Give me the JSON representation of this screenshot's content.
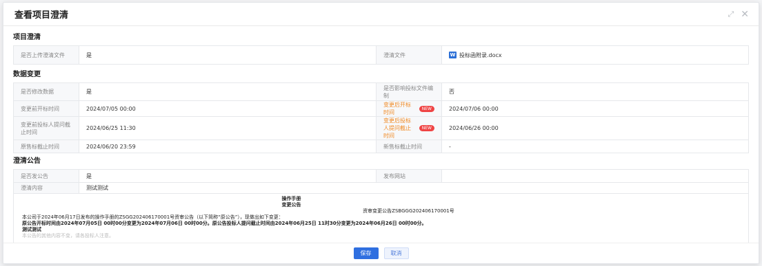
{
  "dialog": {
    "title": "查看项目澄清",
    "icons": [
      "expand-icon",
      "close-icon"
    ],
    "expand_glyph": "⤢",
    "close_glyph": "✕"
  },
  "clarification": {
    "section_title": "项目澄清",
    "upload_label": "是否上传澄清文件",
    "upload_value": "是",
    "file_label": "澄清文件",
    "file_name": "投标函附录.docx",
    "file_icon": "word-doc-icon"
  },
  "data_change": {
    "section_title": "数据变更",
    "modify_label": "是否修改数据",
    "modify_value": "是",
    "affect_label": "是否影响投标文件编制",
    "affect_value": "否",
    "before_open_label": "变更前开标时间",
    "before_open_value": "2024/07/05 00:00",
    "after_open_label": "变更后开标时间",
    "after_open_value": "2024/07/06 00:00",
    "before_question_label": "变更前投标人提问截止时间",
    "before_question_value": "2024/06/25 11:30",
    "after_question_label": "变更后投标人提问截止时间",
    "after_question_value": "2024/06/26 00:00",
    "orig_sale_label": "原售标截止时间",
    "orig_sale_value": "2024/06/20 23:59",
    "new_sale_label": "新售标截止时间",
    "new_sale_value": "-",
    "new_badge": "NEW"
  },
  "notice": {
    "section_title": "澄清公告",
    "publish_label": "是否发公告",
    "publish_value": "是",
    "site_label": "发布网站",
    "site_value": "",
    "content_label": "澄清内容",
    "content_value": "测试测试",
    "line1": "操作手册",
    "line2": "变更公告",
    "doc_title": "资审变更公告ZSBGGG202406170001号",
    "para1": "本公司于2024年06月17日发布的操作手册的ZSGG202406170001号资审公告（以下简称“原公告”），现做出如下变更：",
    "para2": "原公告开标时间由2024年07月05日 00时00分变更为2024年07月06日 00时00分。原公告投标人提问截止时间由2024年06月25日 11时30分变更为2024年06月26日 00时00分。",
    "para3": "测试测试",
    "para4": "本公告的其他内容不变，请各投标人注意。"
  },
  "footer": {
    "save_label": "保存",
    "cancel_label": "取消"
  },
  "colors": {
    "primary": "#2f6fe0",
    "warning_label": "#f08a24",
    "badge": "#ef4444"
  }
}
